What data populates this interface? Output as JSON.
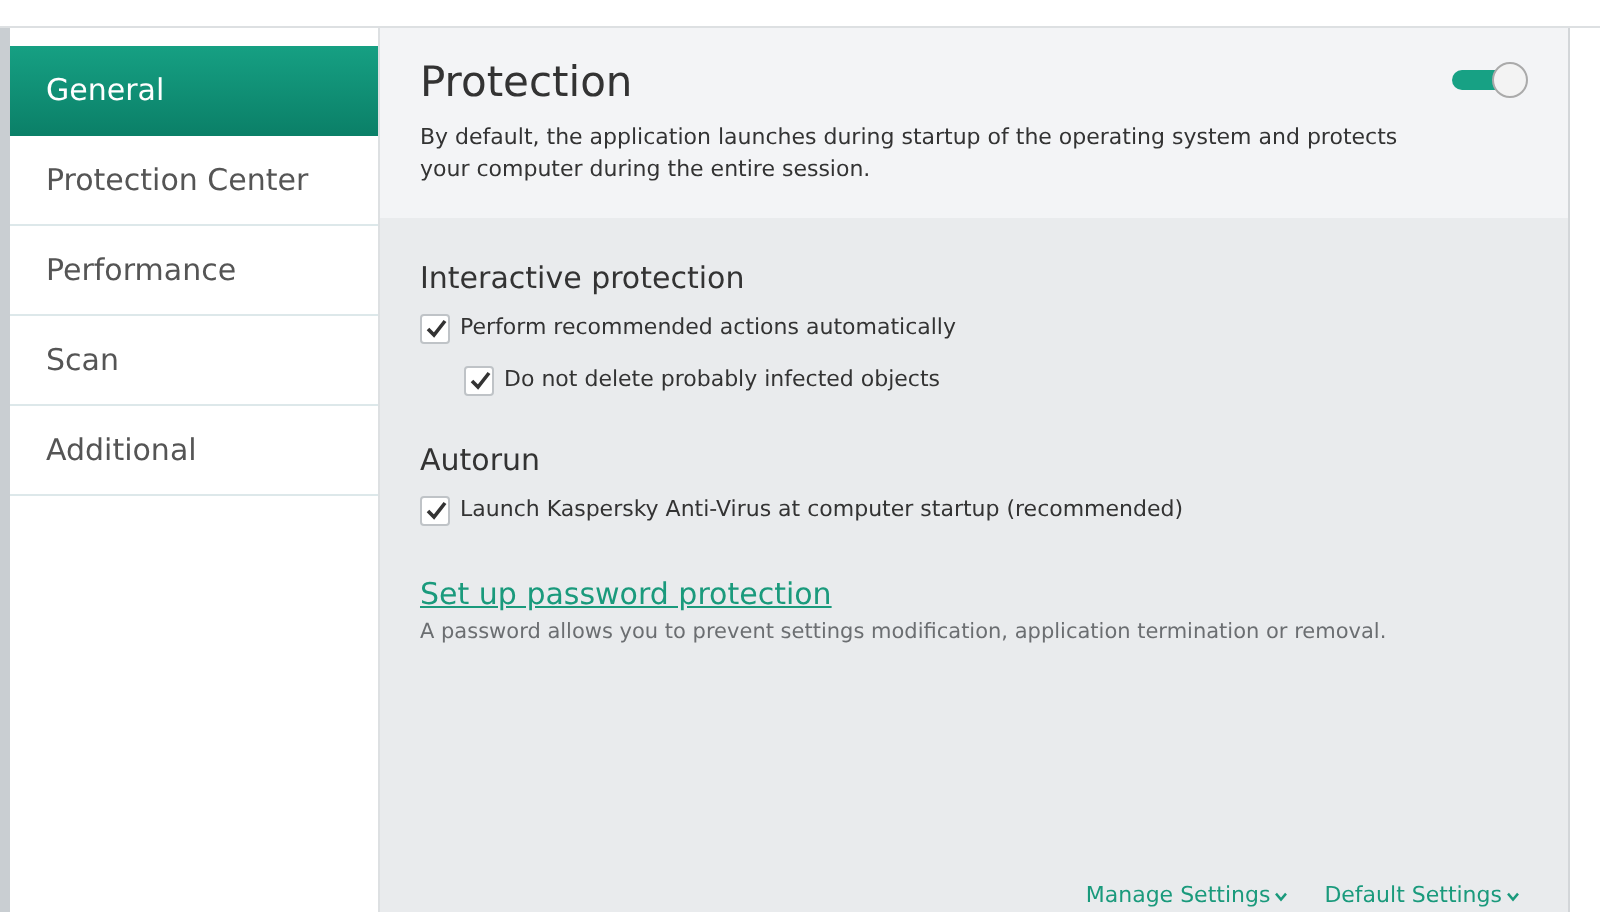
{
  "sidebar": {
    "items": [
      {
        "label": "General",
        "selected": true
      },
      {
        "label": "Protection Center",
        "selected": false
      },
      {
        "label": "Performance",
        "selected": false
      },
      {
        "label": "Scan",
        "selected": false
      },
      {
        "label": "Additional",
        "selected": false
      }
    ]
  },
  "header": {
    "title": "Protection",
    "description": "By default, the application launches during startup of the operating system and protects your computer during the entire session.",
    "toggle": {
      "on": true
    }
  },
  "sections": [
    {
      "title": "Interactive protection",
      "options": [
        {
          "label": "Perform recommended actions automatically",
          "checked": true,
          "children": [
            {
              "label": "Do not delete probably infected objects",
              "checked": true
            }
          ]
        }
      ]
    },
    {
      "title": "Autorun",
      "options": [
        {
          "label": "Launch Kaspersky Anti-Virus at computer startup (recommended)",
          "checked": true
        }
      ]
    }
  ],
  "password": {
    "link": "Set up password protection",
    "hint": "A password allows you to prevent settings modification, application termination or removal."
  },
  "footer_links": [
    "Manage Settings",
    "Default Settings"
  ]
}
